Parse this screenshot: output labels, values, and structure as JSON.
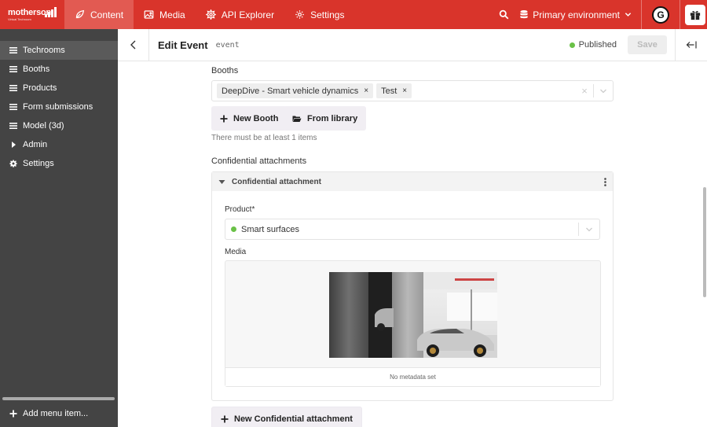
{
  "brand": {
    "name": "motherson",
    "tagline": "Virtual Techroom"
  },
  "topnav": {
    "items": [
      {
        "label": "Content",
        "icon": "leaf-icon",
        "active": true
      },
      {
        "label": "Media",
        "icon": "image-icon"
      },
      {
        "label": "API Explorer",
        "icon": "api-icon"
      },
      {
        "label": "Settings",
        "icon": "gear-icon"
      }
    ],
    "environment": "Primary environment",
    "avatar_initial": "G"
  },
  "sidebar": {
    "items": [
      {
        "label": "Techrooms",
        "icon": "menu-icon",
        "active": true
      },
      {
        "label": "Booths",
        "icon": "menu-icon"
      },
      {
        "label": "Products",
        "icon": "menu-icon"
      },
      {
        "label": "Form submissions",
        "icon": "menu-icon"
      },
      {
        "label": "Model (3d)",
        "icon": "menu-icon"
      },
      {
        "label": "Admin",
        "icon": "caret-right-icon"
      },
      {
        "label": "Settings",
        "icon": "gear-icon"
      }
    ],
    "add_label": "Add menu item..."
  },
  "header": {
    "title": "Edit Event",
    "model_id": "event",
    "status": "Published",
    "save_label": "Save"
  },
  "form": {
    "booths": {
      "label": "Booths",
      "chips": [
        "DeepDive - Smart vehicle dynamics",
        "Test"
      ],
      "chip_remove": "×",
      "clear": "×",
      "new_label": "New Booth",
      "library_label": "From library",
      "hint": "There must be at least 1 items"
    },
    "attachments": {
      "label": "Confidential attachments",
      "block_title": "Confidential attachment",
      "product_label": "Product*",
      "product_value": "Smart surfaces",
      "media_label": "Media",
      "media_meta": "No metadata set",
      "new_label": "New Confidential attachment"
    }
  },
  "colors": {
    "brand_red": "#d9342b",
    "sidebar": "#444444",
    "published": "#6ac147"
  }
}
